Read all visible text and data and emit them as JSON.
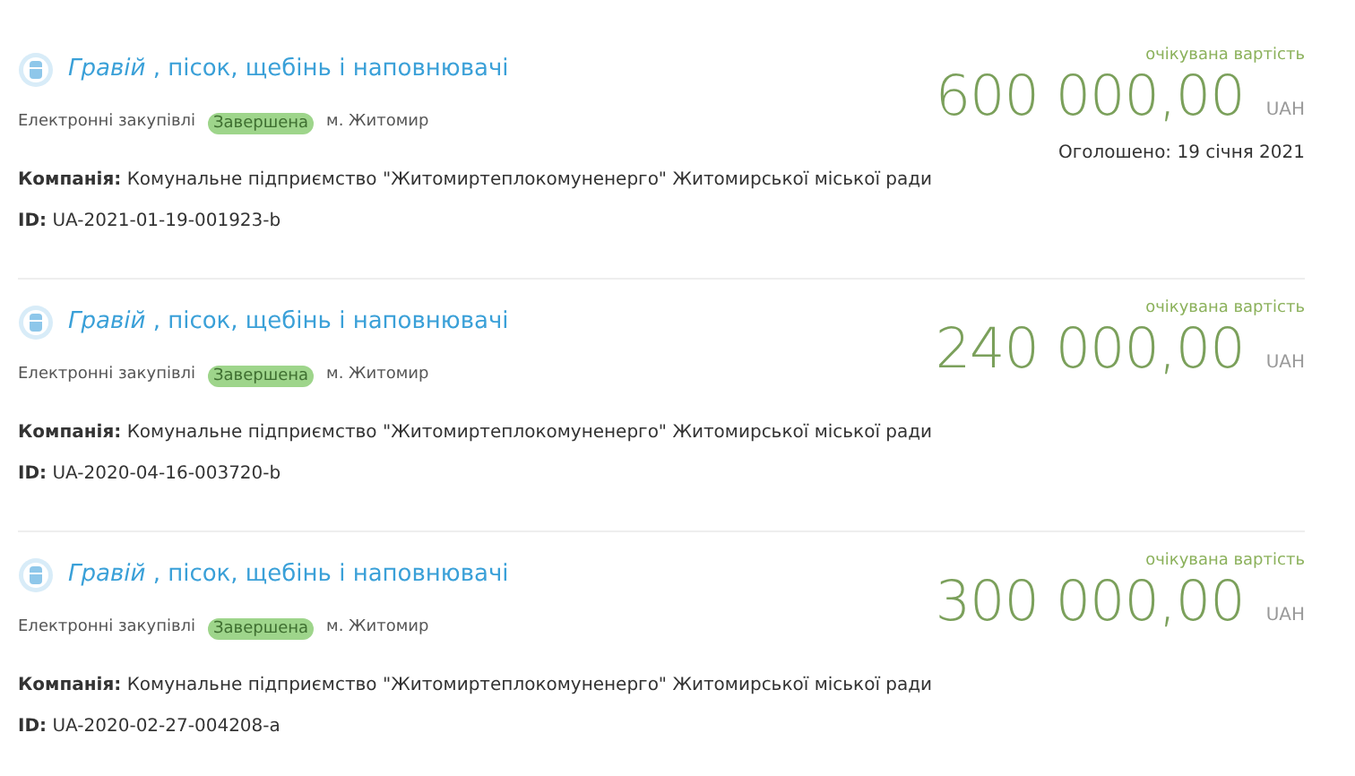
{
  "tenders": [
    {
      "title": "*Гравій* , пісок, щебінь і наповнювачі",
      "procedure": "Електронні закупівлі",
      "status": "Завершена",
      "city": "м. Житомир",
      "company_label": "Компанія:",
      "company": "Комунальне підприємство \"Житомиртеплокомуненерго\" Житомирської міської ради",
      "id_label": "ID:",
      "id": "UA-2021-01-19-001923-b",
      "value_label": "очікувана вартість",
      "amount": "600 000,00",
      "currency": "UAH",
      "announced": "Оголошено: 19 січня 2021"
    },
    {
      "title": "*Гравій* , пісок, щебінь і наповнювачі",
      "procedure": "Електронні закупівлі",
      "status": "Завершена",
      "city": "м. Житомир",
      "company_label": "Компанія:",
      "company": "Комунальне підприємство \"Житомиртеплокомуненерго\" Житомирської міської ради",
      "id_label": "ID:",
      "id": "UA-2020-04-16-003720-b",
      "value_label": "очікувана вартість",
      "amount": "240 000,00",
      "currency": "UAH"
    },
    {
      "title": "*Гравій* , пісок, щебінь і наповнювачі",
      "procedure": "Електронні закупівлі",
      "status": "Завершена",
      "city": "м. Житомир",
      "company_label": "Компанія:",
      "company": "Комунальне підприємство \"Житомиртеплокомуненерго\" Житомирської міської ради",
      "id_label": "ID:",
      "id": "UA-2020-02-27-004208-a",
      "value_label": "очікувана вартість",
      "amount": "300 000,00",
      "currency": "UAH"
    }
  ]
}
